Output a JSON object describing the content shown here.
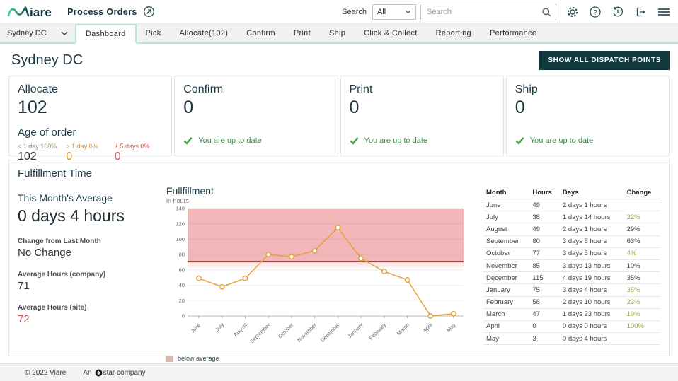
{
  "header": {
    "logo_text": "iare",
    "app_title": "Process Orders",
    "search_label": "Search",
    "search_scope": "All",
    "search_placeholder": "Search"
  },
  "nav": {
    "site_selector": "Sydney DC",
    "tabs": [
      {
        "label": "Dashboard",
        "active": true
      },
      {
        "label": "Pick",
        "active": false
      },
      {
        "label": "Allocate(102)",
        "active": false
      },
      {
        "label": "Confirm",
        "active": false
      },
      {
        "label": "Print",
        "active": false
      },
      {
        "label": "Ship",
        "active": false
      },
      {
        "label": "Click & Collect",
        "active": false
      },
      {
        "label": "Reporting",
        "active": false
      },
      {
        "label": "Performance",
        "active": false
      }
    ]
  },
  "page": {
    "title": "Sydney DC",
    "action_button": "SHOW ALL DISPATCH POINTS"
  },
  "cards": [
    {
      "title": "Allocate",
      "count": "102",
      "age_of_order": {
        "title": "Age of order",
        "buckets": [
          {
            "label": "< 1 day 100%",
            "value": "102",
            "label_color": "#9b8c72",
            "value_color": "#2e2e2e"
          },
          {
            "label": "> 1 day 0%",
            "value": "0",
            "label_color": "#d6922f",
            "value_color": "#d6922f"
          },
          {
            "label": "+ 5 days 0%",
            "value": "0",
            "label_color": "#d9544a",
            "value_color": "#d9544a"
          }
        ]
      }
    },
    {
      "title": "Confirm",
      "count": "0",
      "status": "You are up to date"
    },
    {
      "title": "Print",
      "count": "0",
      "status": "You are up to date"
    },
    {
      "title": "Ship",
      "count": "0",
      "status": "You are up to date"
    }
  ],
  "fulfillment": {
    "section_title": "Fulfillment Time",
    "this_month_label": "This Month's Average",
    "this_month_value": "0 days 4 hours",
    "change_label": "Change from Last Month",
    "change_value": "No Change",
    "company_label": "Average Hours (company)",
    "company_value": "71",
    "site_label": "Average Hours (site)",
    "site_value": "72"
  },
  "chart_data": {
    "type": "line",
    "title": "Fullfillment",
    "subtitle": "in hours",
    "categories": [
      "June",
      "July",
      "August",
      "September",
      "October",
      "November",
      "December",
      "January",
      "February",
      "March",
      "April",
      "May"
    ],
    "values": [
      49,
      38,
      49,
      80,
      77,
      85,
      115,
      75,
      58,
      47,
      0,
      3
    ],
    "ylim": [
      0,
      140
    ],
    "ytick_step": 20,
    "band": {
      "from": 71,
      "to": 140,
      "color": "#f2b6b9"
    },
    "average_line": {
      "value": 71,
      "color": "#9a4f43"
    },
    "line_color": "#e1a23a",
    "marker_fill": "#ffffff",
    "grid": true,
    "legend": [
      {
        "label": "below average",
        "swatch": "#d9b8ab"
      }
    ]
  },
  "table": {
    "headers": [
      "Month",
      "Hours",
      "Days",
      "Change"
    ],
    "rows": [
      {
        "month": "June",
        "hours": "49",
        "days": "2 days 1 hours",
        "change": "",
        "green": false
      },
      {
        "month": "July",
        "hours": "38",
        "days": "1 days 14 hours",
        "change": "22%",
        "green": true
      },
      {
        "month": "August",
        "hours": "49",
        "days": "2 days 1 hours",
        "change": "29%",
        "green": false
      },
      {
        "month": "September",
        "hours": "80",
        "days": "3 days 8 hours",
        "change": "63%",
        "green": false
      },
      {
        "month": "October",
        "hours": "77",
        "days": "3 days 5 hours",
        "change": "4%",
        "green": true
      },
      {
        "month": "November",
        "hours": "85",
        "days": "3 days 13 hours",
        "change": "10%",
        "green": false
      },
      {
        "month": "December",
        "hours": "115",
        "days": "4 days 19 hours",
        "change": "35%",
        "green": false
      },
      {
        "month": "January",
        "hours": "75",
        "days": "3 days 4 hours",
        "change": "35%",
        "green": true
      },
      {
        "month": "February",
        "hours": "58",
        "days": "2 days 10 hours",
        "change": "23%",
        "green": true
      },
      {
        "month": "March",
        "hours": "47",
        "days": "1 days 23 hours",
        "change": "19%",
        "green": true
      },
      {
        "month": "April",
        "hours": "0",
        "days": "0 days 0 hours",
        "change": "100%",
        "green": true
      },
      {
        "month": "May",
        "hours": "3",
        "days": "0 days 4 hours",
        "change": "",
        "green": false
      }
    ]
  },
  "footer": {
    "copyright": "© 2022 Viare",
    "company_prefix": "An",
    "company_suffix": "star company"
  },
  "colors": {
    "accent_mint": "#b9e7d6",
    "dark_teal": "#1d3a46",
    "button_bg": "#123a3e",
    "check_green": "#3aa23a",
    "status_text_green": "#3c8a46",
    "change_green": "#9cab49",
    "band_pink": "#f2b6b9",
    "average_line_red": "#9a4f43",
    "series_orange": "#e1a23a",
    "site_value_red": "#bf5a4b"
  },
  "icons": {
    "viare_logo": "wave",
    "compass": "circled NE arrow",
    "search": "magnifier",
    "chevron_down": "v",
    "settings": "gear",
    "help": "circled question mark",
    "history": "clock with undo arrow",
    "export": "box with right arrow",
    "menu": "hamburger three lines",
    "check": "checkmark"
  }
}
